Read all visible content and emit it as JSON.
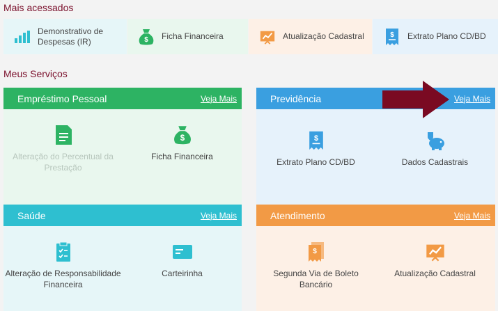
{
  "sections": {
    "most_accessed": "Mais acessados",
    "my_services": "Meus Serviços"
  },
  "quick_links": [
    {
      "label": "Demonstrativo de Despesas (IR)",
      "icon": "bar-chart-icon"
    },
    {
      "label": "Ficha Financeira",
      "icon": "money-bag-icon"
    },
    {
      "label": "Atualização Cadastral",
      "icon": "trend-board-icon"
    },
    {
      "label": "Extrato Plano CD/BD",
      "icon": "receipt-icon"
    }
  ],
  "cards": {
    "emprestimo": {
      "title": "Empréstimo Pessoal",
      "more": "Veja Mais",
      "items": [
        {
          "label": "Alteração do Percentual da Prestação",
          "icon": "document-icon",
          "disabled": true
        },
        {
          "label": "Ficha Financeira",
          "icon": "money-bag-icon"
        }
      ]
    },
    "previdencia": {
      "title": "Previdência",
      "more": "Veja Mais",
      "items": [
        {
          "label": "Extrato Plano CD/BD",
          "icon": "receipt-icon"
        },
        {
          "label": "Dados Cadastrais",
          "icon": "piggy-bank-icon"
        }
      ]
    },
    "saude": {
      "title": "Saúde",
      "more": "Veja Mais",
      "items": [
        {
          "label": "Alteração de Responsabilidade Financeira",
          "icon": "clipboard-check-icon"
        },
        {
          "label": "Carteirinha",
          "icon": "card-icon"
        }
      ]
    },
    "atendimento": {
      "title": "Atendimento",
      "more": "Veja Mais",
      "items": [
        {
          "label": "Segunda Via de Boleto Bancário",
          "icon": "receipts-icon"
        },
        {
          "label": "Atualização Cadastral",
          "icon": "trend-board-icon"
        }
      ]
    }
  },
  "colors": {
    "title": "#7a0f2b",
    "green": "#2db363",
    "blue": "#3a9fe0",
    "teal": "#2ebfd0",
    "orange": "#f29a45",
    "arrow": "#7a0a22"
  }
}
